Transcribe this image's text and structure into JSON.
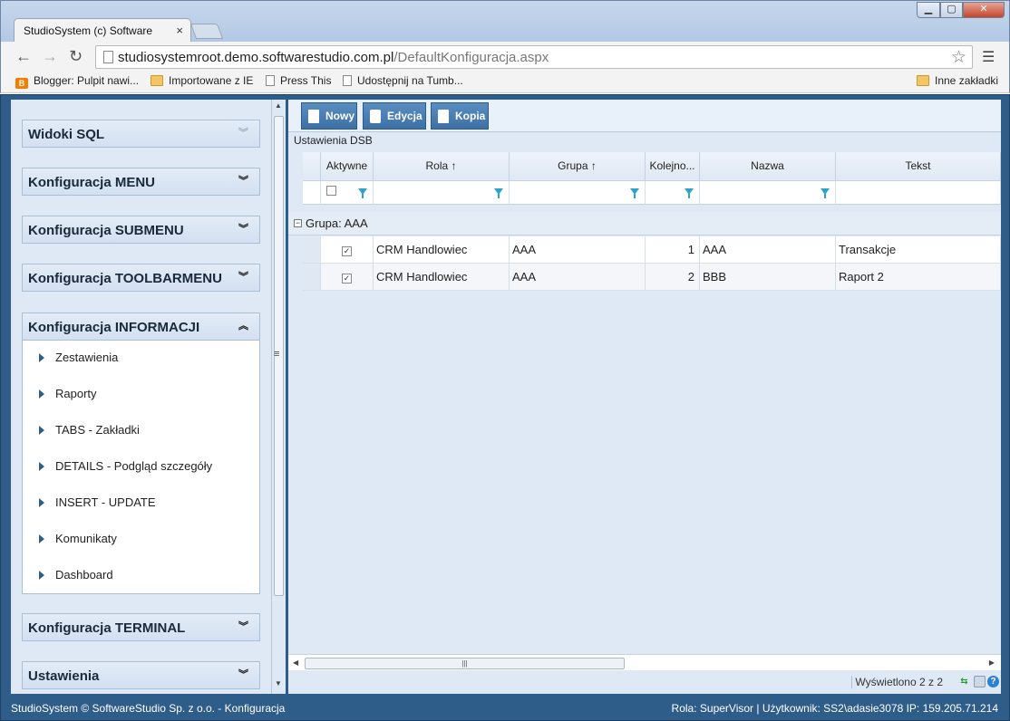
{
  "browser": {
    "tab_title": "StudioSystem (c) Software",
    "url_host": "studiosystemroot.demo.softwarestudio.com.pl",
    "url_path": "/DefaultKonfiguracja.aspx",
    "bookmarks": [
      {
        "label": "Blogger: Pulpit nawi...",
        "icon": "blogger-icon"
      },
      {
        "label": "Importowane z IE",
        "icon": "folder-icon"
      },
      {
        "label": "Press This",
        "icon": "page-icon"
      },
      {
        "label": "Udostępnij na Tumb...",
        "icon": "page-icon"
      }
    ],
    "other_bookmarks": "Inne zakładki"
  },
  "sidebar": {
    "sections": [
      {
        "label": "Widoki SQL"
      },
      {
        "label": "Konfiguracja MENU"
      },
      {
        "label": "Konfiguracja SUBMENU"
      },
      {
        "label": "Konfiguracja TOOLBARMENU"
      },
      {
        "label": "Konfiguracja INFORMACJI"
      },
      {
        "label": "Konfiguracja TERMINAL"
      },
      {
        "label": "Ustawienia"
      }
    ],
    "expanded_items": [
      "Zestawienia",
      "Raporty",
      "TABS - Zakładki",
      "DETAILS - Podgląd szczegóły",
      "INSERT - UPDATE",
      "Komunikaty",
      "Dashboard"
    ]
  },
  "toolbar": {
    "new_label": "Nowy",
    "edit_label": "Edycja",
    "copy_label": "Kopia"
  },
  "grid": {
    "caption": "Ustawienia DSB",
    "columns": [
      "Aktywne",
      "Rola ↑",
      "Grupa ↑",
      "Kolejno...",
      "Nazwa",
      "Tekst"
    ],
    "group_label": "Grupa: AAA",
    "rows": [
      {
        "aktywne": true,
        "rola": "CRM Handlowiec",
        "grupa": "AAA",
        "kolejnosc": "1",
        "nazwa": "AAA",
        "tekst": "Transakcje"
      },
      {
        "aktywne": true,
        "rola": "CRM Handlowiec",
        "grupa": "AAA",
        "kolejnosc": "2",
        "nazwa": "BBB",
        "tekst": "Raport 2"
      }
    ],
    "count_label": "Wyświetlono 2 z 2"
  },
  "footer": {
    "left": "StudioSystem © SoftwareStudio Sp. z o.o. - Konfiguracja",
    "right": "Rola: SuperVisor | Użytkownik: SS2\\adasie3078 IP: 159.205.71.214"
  },
  "colors": {
    "app_frame": "#2f5d8a",
    "panel_bg": "#dfe8f5",
    "button": "#4a7db2"
  }
}
